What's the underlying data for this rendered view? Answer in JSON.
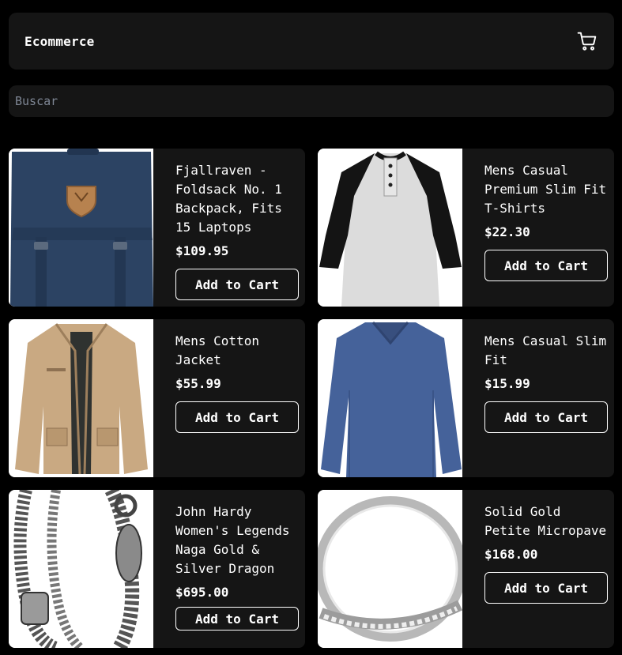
{
  "header": {
    "title": "Ecommerce"
  },
  "search": {
    "placeholder": "Buscar"
  },
  "products": [
    {
      "name": "Fjallraven - Foldsack No. 1 Backpack, Fits 15 Laptops",
      "price": "$109.95",
      "button": "Add to Cart",
      "image_icon": "backpack-image"
    },
    {
      "name": "Mens Casual Premium Slim Fit T-Shirts",
      "price": "$22.30",
      "button": "Add to Cart",
      "image_icon": "raglan-shirt-image"
    },
    {
      "name": "Mens Cotton Jacket",
      "price": "$55.99",
      "button": "Add to Cart",
      "image_icon": "jacket-image"
    },
    {
      "name": "Mens Casual Slim Fit",
      "price": "$15.99",
      "button": "Add to Cart",
      "image_icon": "long-sleeve-shirt-image"
    },
    {
      "name": "John Hardy Women's Legends Naga Gold & Silver Dragon Station Chain Bracelet",
      "price": "$695.00",
      "button": "Add to Cart",
      "image_icon": "bracelet-image"
    },
    {
      "name": "Solid Gold Petite Micropave",
      "price": "$168.00",
      "button": "Add to Cart",
      "image_icon": "ring-image"
    }
  ],
  "colors": {
    "background": "#000000",
    "card": "#151515",
    "text": "#ffffff",
    "placeholder": "#7e8694"
  }
}
